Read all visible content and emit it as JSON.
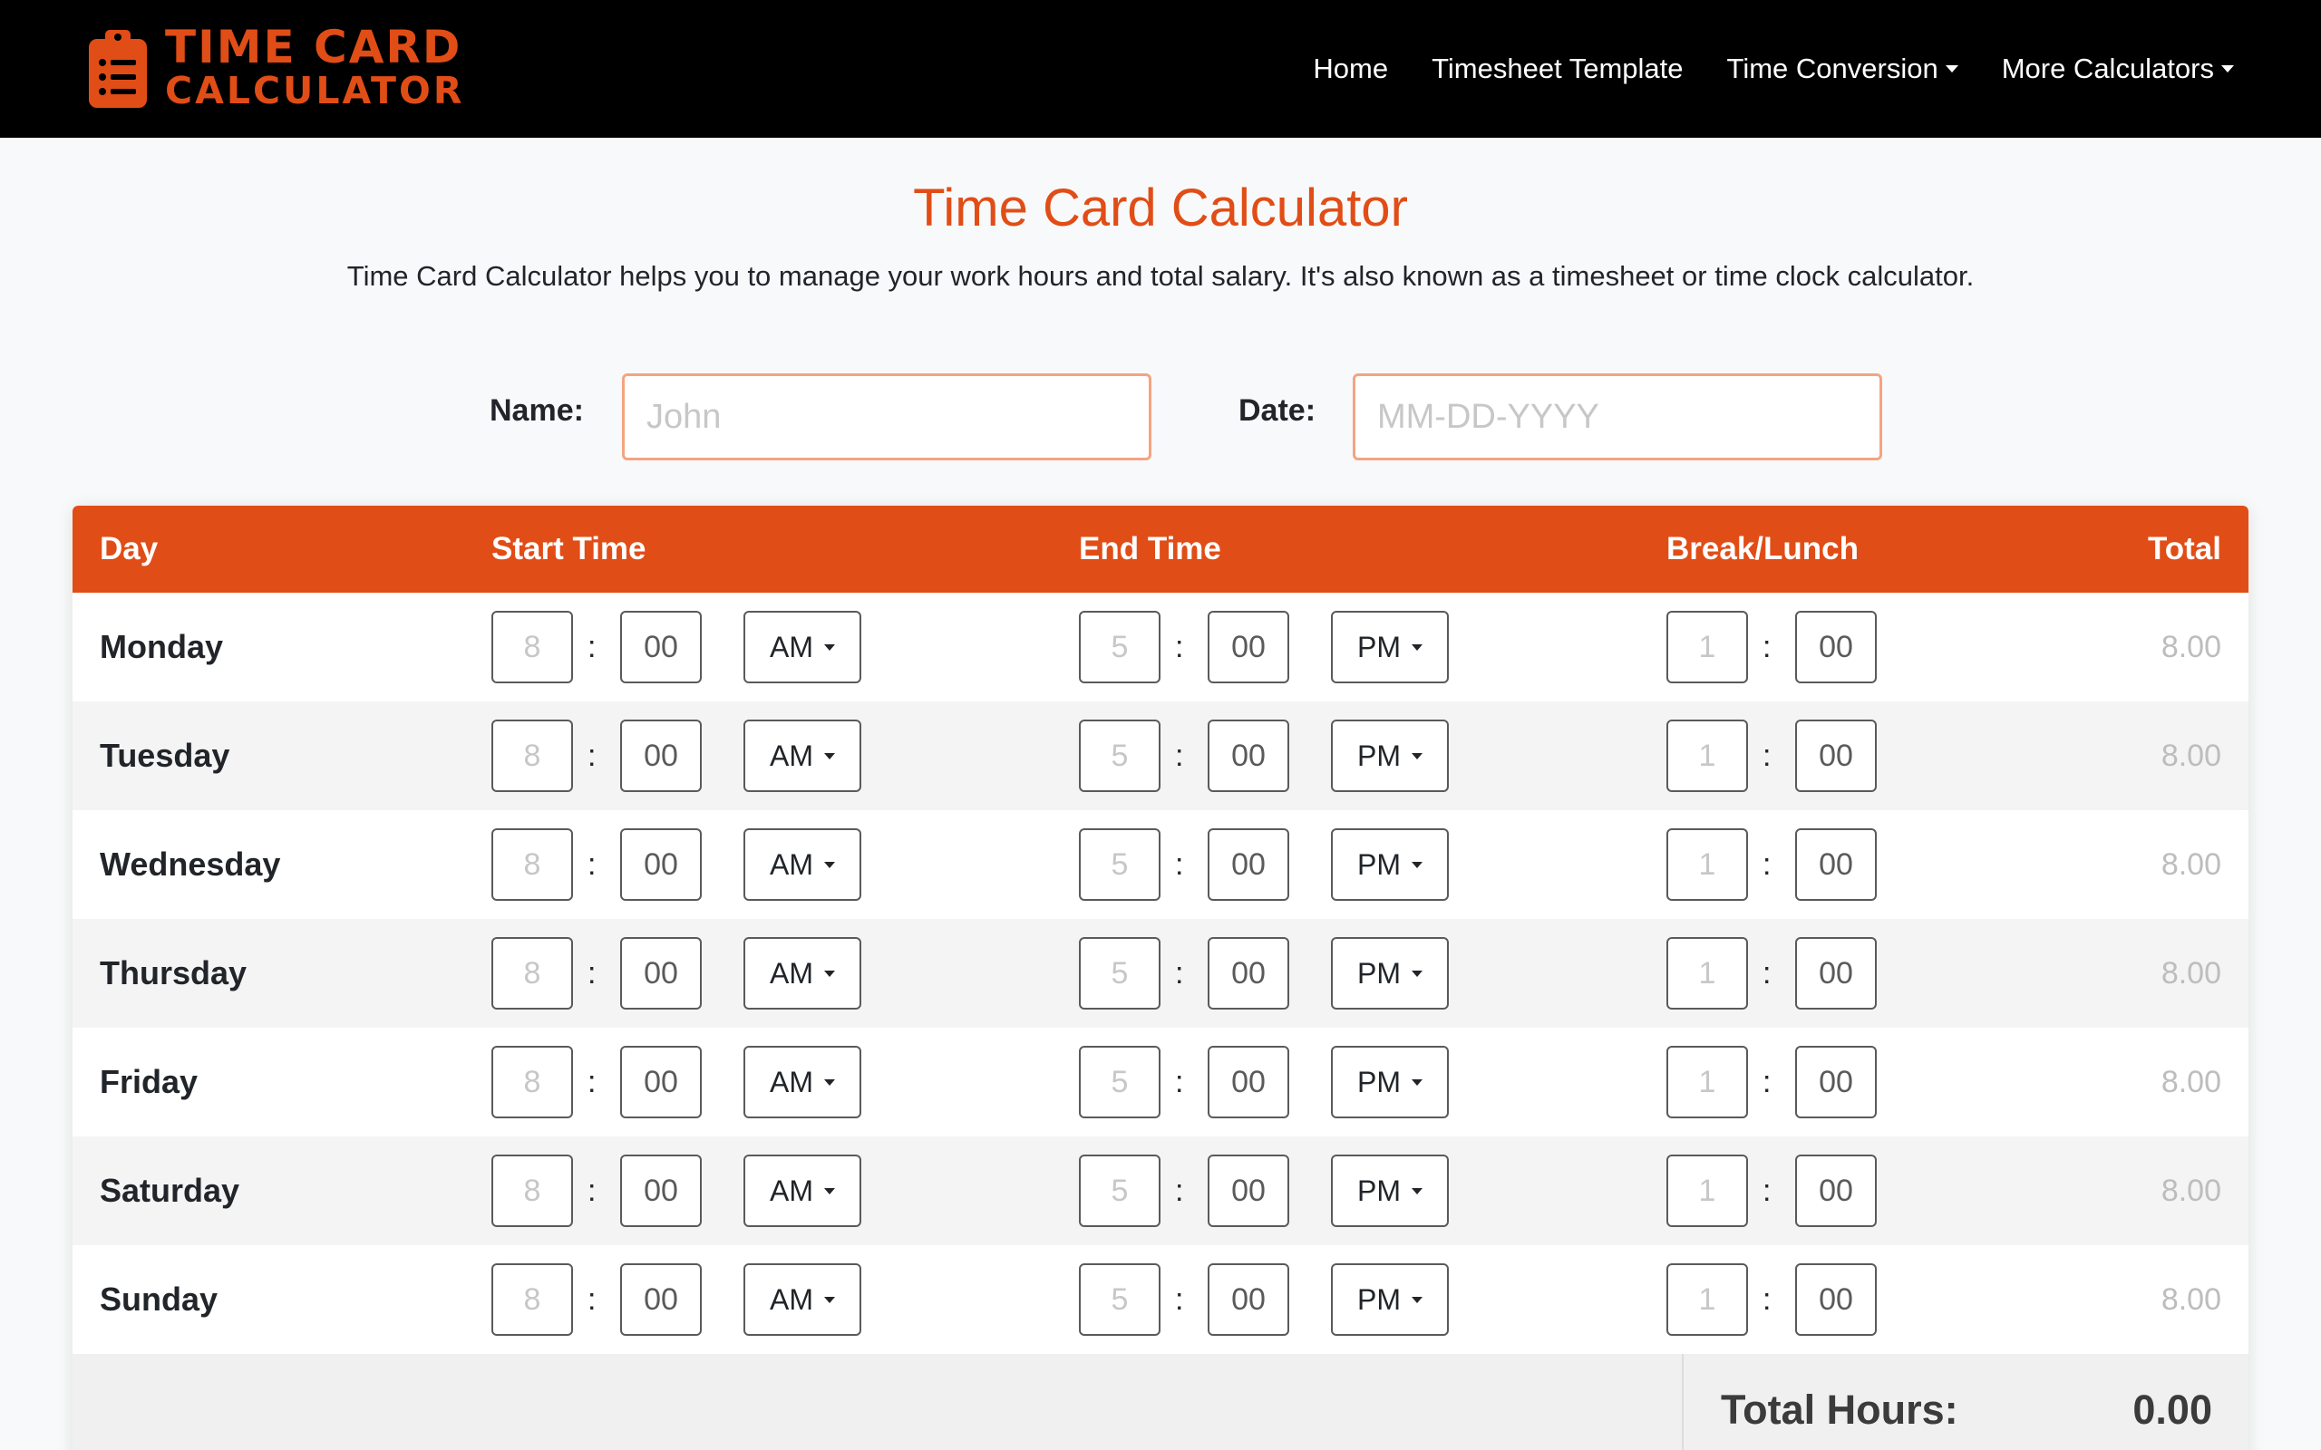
{
  "brand": {
    "line1": "TIME CARD",
    "line2": "CALCULATOR",
    "icon": "clipboard-list-icon",
    "color": "#e14d16"
  },
  "nav": {
    "home": "Home",
    "timesheet": "Timesheet Template",
    "conversion": "Time Conversion",
    "more": "More Calculators"
  },
  "header": {
    "title": "Time Card Calculator",
    "intro": "Time Card Calculator helps you to manage your work hours and total salary. It's also known as a timesheet or time clock calculator."
  },
  "form": {
    "name_label": "Name:",
    "name_placeholder": "John",
    "date_label": "Date:",
    "date_placeholder": "MM-DD-YYYY"
  },
  "table": {
    "headers": {
      "day": "Day",
      "start": "Start Time",
      "end": "End Time",
      "break": "Break/Lunch",
      "total": "Total"
    },
    "rows": [
      {
        "day": "Monday",
        "start_h": "8",
        "start_m": "00",
        "start_ampm": "AM",
        "end_h": "5",
        "end_m": "00",
        "end_ampm": "PM",
        "break_h": "1",
        "break_m": "00",
        "total": "8.00"
      },
      {
        "day": "Tuesday",
        "start_h": "8",
        "start_m": "00",
        "start_ampm": "AM",
        "end_h": "5",
        "end_m": "00",
        "end_ampm": "PM",
        "break_h": "1",
        "break_m": "00",
        "total": "8.00"
      },
      {
        "day": "Wednesday",
        "start_h": "8",
        "start_m": "00",
        "start_ampm": "AM",
        "end_h": "5",
        "end_m": "00",
        "end_ampm": "PM",
        "break_h": "1",
        "break_m": "00",
        "total": "8.00"
      },
      {
        "day": "Thursday",
        "start_h": "8",
        "start_m": "00",
        "start_ampm": "AM",
        "end_h": "5",
        "end_m": "00",
        "end_ampm": "PM",
        "break_h": "1",
        "break_m": "00",
        "total": "8.00"
      },
      {
        "day": "Friday",
        "start_h": "8",
        "start_m": "00",
        "start_ampm": "AM",
        "end_h": "5",
        "end_m": "00",
        "end_ampm": "PM",
        "break_h": "1",
        "break_m": "00",
        "total": "8.00"
      },
      {
        "day": "Saturday",
        "start_h": "8",
        "start_m": "00",
        "start_ampm": "AM",
        "end_h": "5",
        "end_m": "00",
        "end_ampm": "PM",
        "break_h": "1",
        "break_m": "00",
        "total": "8.00"
      },
      {
        "day": "Sunday",
        "start_h": "8",
        "start_m": "00",
        "start_ampm": "AM",
        "end_h": "5",
        "end_m": "00",
        "end_ampm": "PM",
        "break_h": "1",
        "break_m": "00",
        "total": "8.00"
      }
    ],
    "total_hours_label": "Total Hours:",
    "total_hours_value": "0.00"
  }
}
